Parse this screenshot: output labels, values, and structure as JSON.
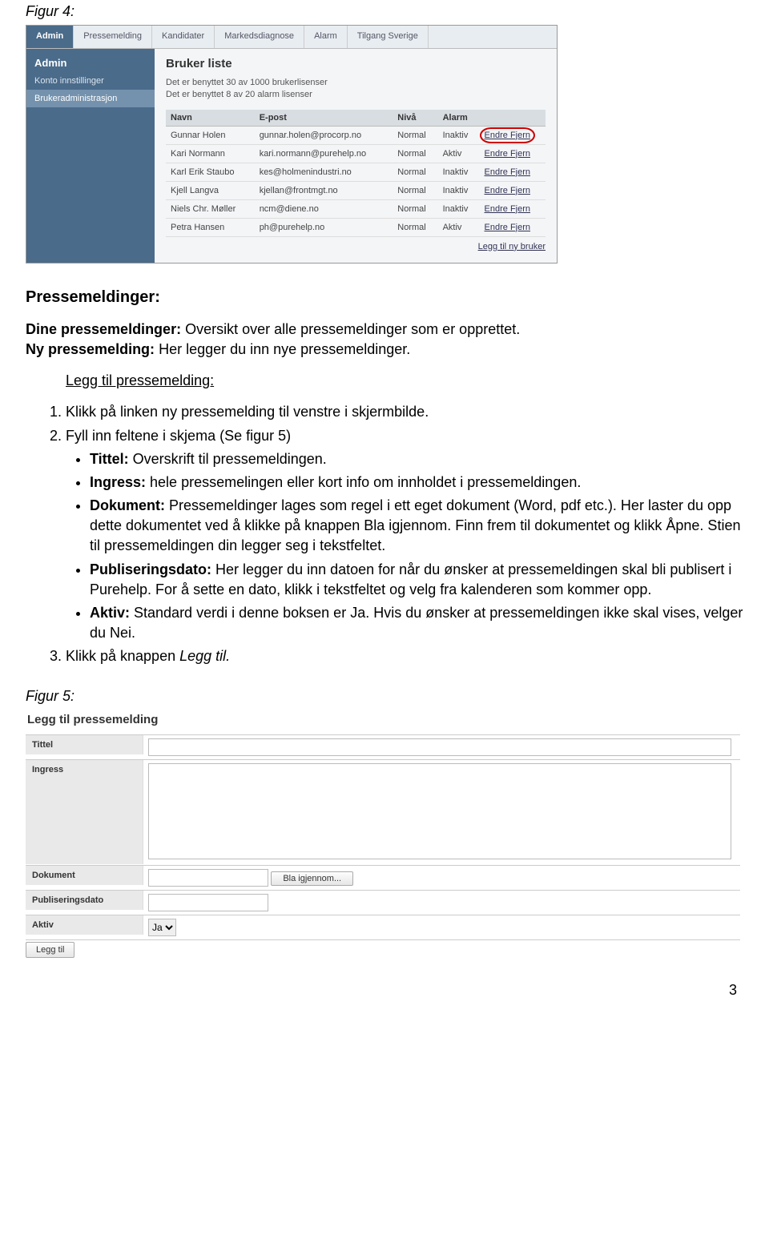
{
  "fig4_label": "Figur 4:",
  "topnav": [
    "Admin",
    "Pressemelding",
    "Kandidater",
    "Markedsdiagnose",
    "Alarm",
    "Tilgang Sverige"
  ],
  "sidenav": {
    "header": "Admin",
    "items": [
      "Konto innstillinger",
      "Brukeradministrasjon"
    ],
    "selected_index": 1
  },
  "content1": {
    "title": "Bruker liste",
    "line1": "Det er benyttet 30 av 1000 brukerlisenser",
    "line2": "Det er benyttet 8 av 20 alarm lisenser",
    "cols": [
      "Navn",
      "E-post",
      "Nivå",
      "Alarm",
      ""
    ],
    "rows": [
      {
        "name": "Gunnar Holen",
        "email": "gunnar.holen@procorp.no",
        "level": "Normal",
        "alarm": "Inaktiv",
        "actions": "Endre Fjern",
        "circled": true
      },
      {
        "name": "Kari Normann",
        "email": "kari.normann@purehelp.no",
        "level": "Normal",
        "alarm": "Aktiv",
        "actions": "Endre Fjern"
      },
      {
        "name": "Karl Erik Staubo",
        "email": "kes@holmenindustri.no",
        "level": "Normal",
        "alarm": "Inaktiv",
        "actions": "Endre Fjern"
      },
      {
        "name": "Kjell Langva",
        "email": "kjellan@frontmgt.no",
        "level": "Normal",
        "alarm": "Inaktiv",
        "actions": "Endre Fjern"
      },
      {
        "name": "Niels Chr. Møller",
        "email": "ncm@diene.no",
        "level": "Normal",
        "alarm": "Inaktiv",
        "actions": "Endre Fjern"
      },
      {
        "name": "Petra Hansen",
        "email": "ph@purehelp.no",
        "level": "Normal",
        "alarm": "Aktiv",
        "actions": "Endre Fjern"
      }
    ],
    "addlink": "Legg til ny bruker"
  },
  "section": {
    "h3": "Pressemeldinger:",
    "p1a": "Dine pressemeldinger:",
    "p1b": " Oversikt over alle pressemeldinger som er opprettet.",
    "p2a": "Ny pressemelding:",
    "p2b": " Her legger du inn nye pressemeldinger.",
    "link": "Legg til pressemelding:",
    "li1": "Klikk på linken ny pressemelding til venstre i skjermbilde.",
    "li2": "Fyll inn feltene i skjema (Se figur 5)",
    "b_tittel": "Tittel:",
    "t_tittel": " Overskrift til pressemeldingen.",
    "b_ingress": "Ingress:",
    "t_ingress": " hele pressemelingen eller kort info om innholdet i pressemeldingen.",
    "b_dok": "Dokument:",
    "t_dok": " Pressemeldinger lages som regel i ett eget dokument (Word, pdf etc.). Her laster du opp dette dokumentet ved å klikke på knappen Bla igjennom. Finn frem til dokumentet og klikk Åpne. Stien til pressemeldingen din legger seg i tekstfeltet.",
    "b_pub": "Publiseringsdato:",
    "t_pub": " Her legger du inn datoen for når du ønsker at pressemeldingen skal bli publisert i Purehelp. For å sette en dato, klikk i tekstfeltet og velg fra kalenderen som kommer opp.",
    "b_aktiv": "Aktiv:",
    "t_aktiv": " Standard verdi i denne boksen er Ja. Hvis du ønsker at pressemeldingen ikke skal vises, velger du Nei.",
    "li3": "Klikk på knappen ",
    "li3i": "Legg til."
  },
  "fig5_label": "Figur 5:",
  "form": {
    "title": "Legg til pressemelding",
    "labels": {
      "tittel": "Tittel",
      "ingress": "Ingress",
      "dokument": "Dokument",
      "pubdato": "Publiseringsdato",
      "aktiv": "Aktiv"
    },
    "browse_btn": "Bla igjennom...",
    "aktiv_value": "Ja",
    "submit": "Legg til"
  },
  "pagenum": "3"
}
